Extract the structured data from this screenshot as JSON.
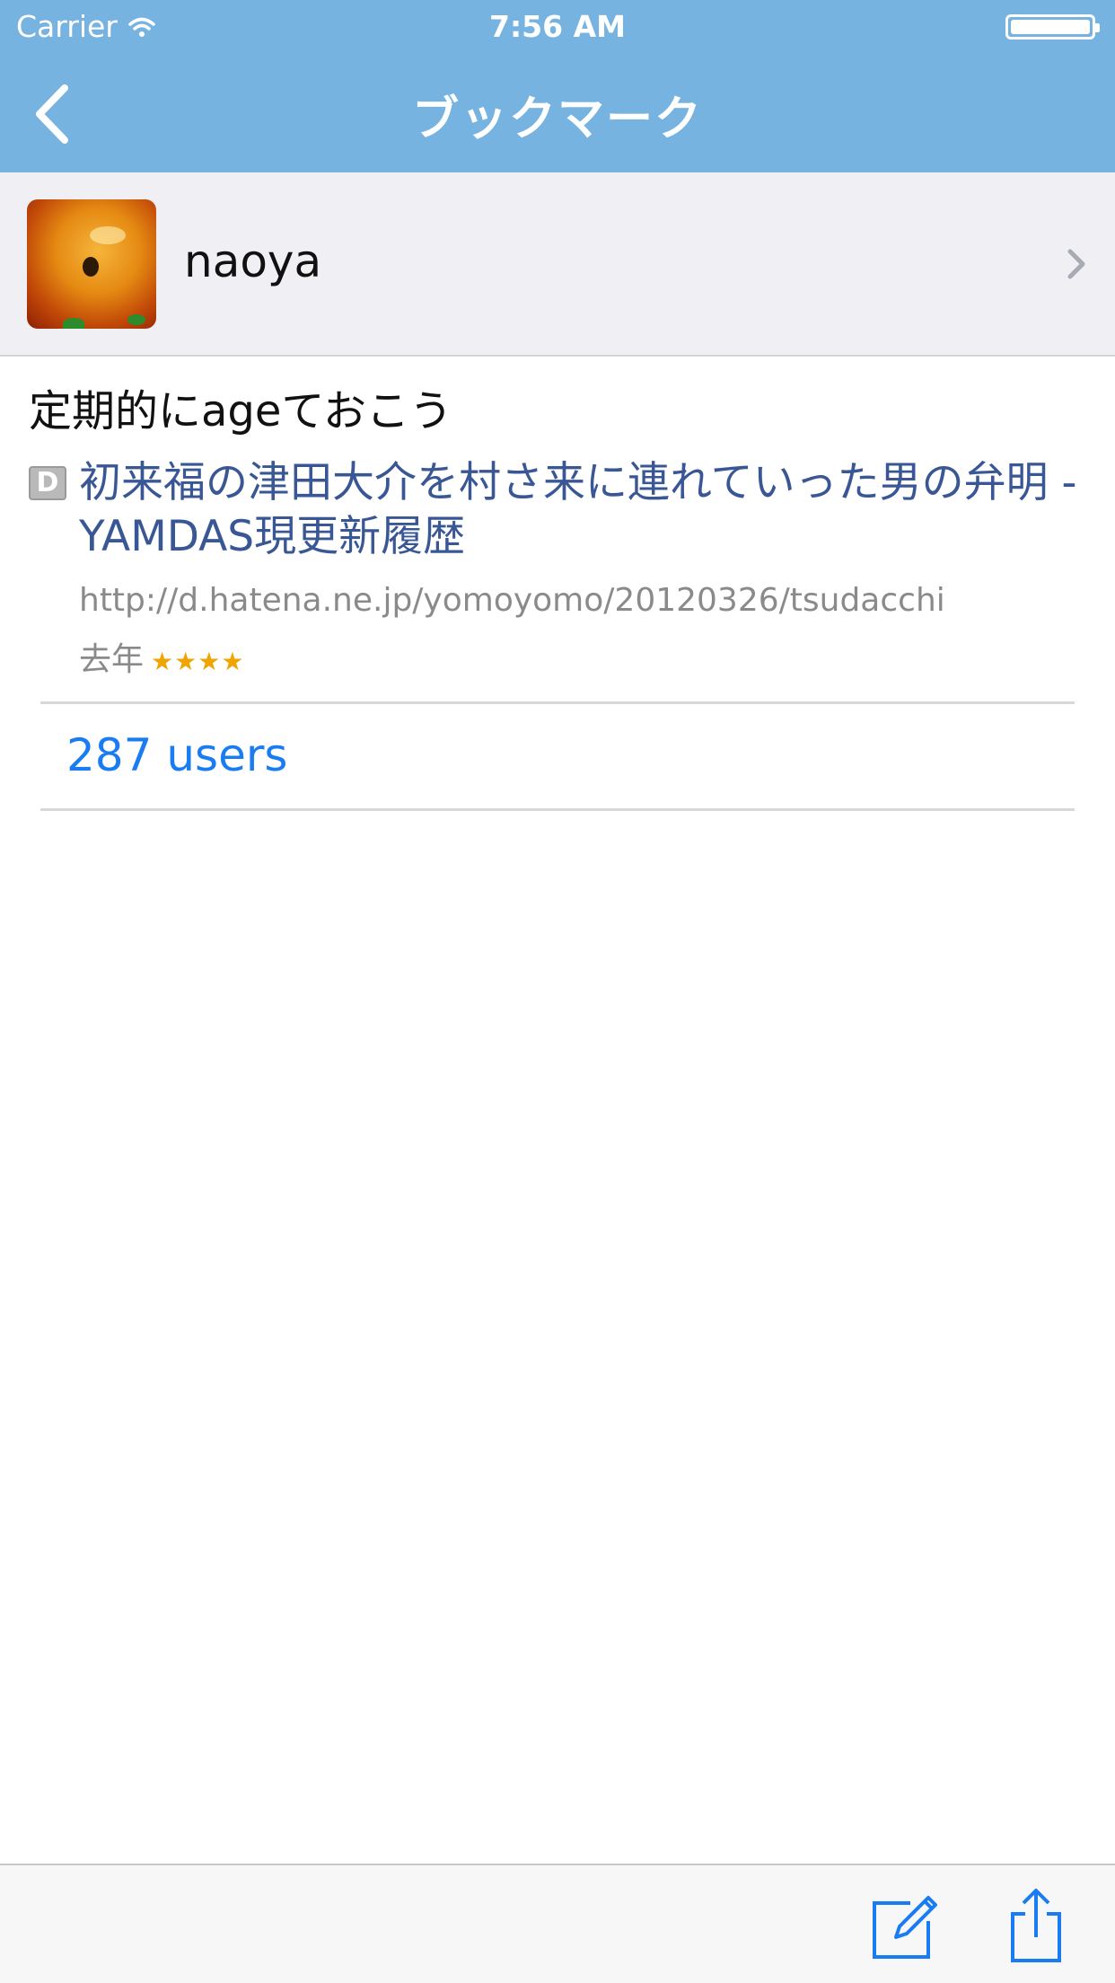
{
  "status_bar": {
    "carrier": "Carrier",
    "time": "7:56 AM"
  },
  "nav": {
    "title": "ブックマーク",
    "back_icon": "chevron-left-icon"
  },
  "user": {
    "name": "naoya",
    "avatar_icon": "avatar-image",
    "chevron_icon": "chevron-right-icon"
  },
  "bookmark": {
    "comment": "定期的にageておこう",
    "entry_icon_label": "D",
    "title": "初来福の津田大介を村さ来に連れていった男の弁明 - YAMDAS現更新履歴",
    "url": "http://d.hatena.ne.jp/yomoyomo/20120326/tsudacchi",
    "date": "去年",
    "stars": "★★★★",
    "star_count": 4,
    "users": "287 users"
  },
  "toolbar": {
    "edit_icon": "compose-icon",
    "share_icon": "share-icon"
  },
  "colors": {
    "nav_bg": "#77b3e1",
    "link": "#1a7cf2",
    "title_link": "#3a5795",
    "star": "#f0a400"
  }
}
